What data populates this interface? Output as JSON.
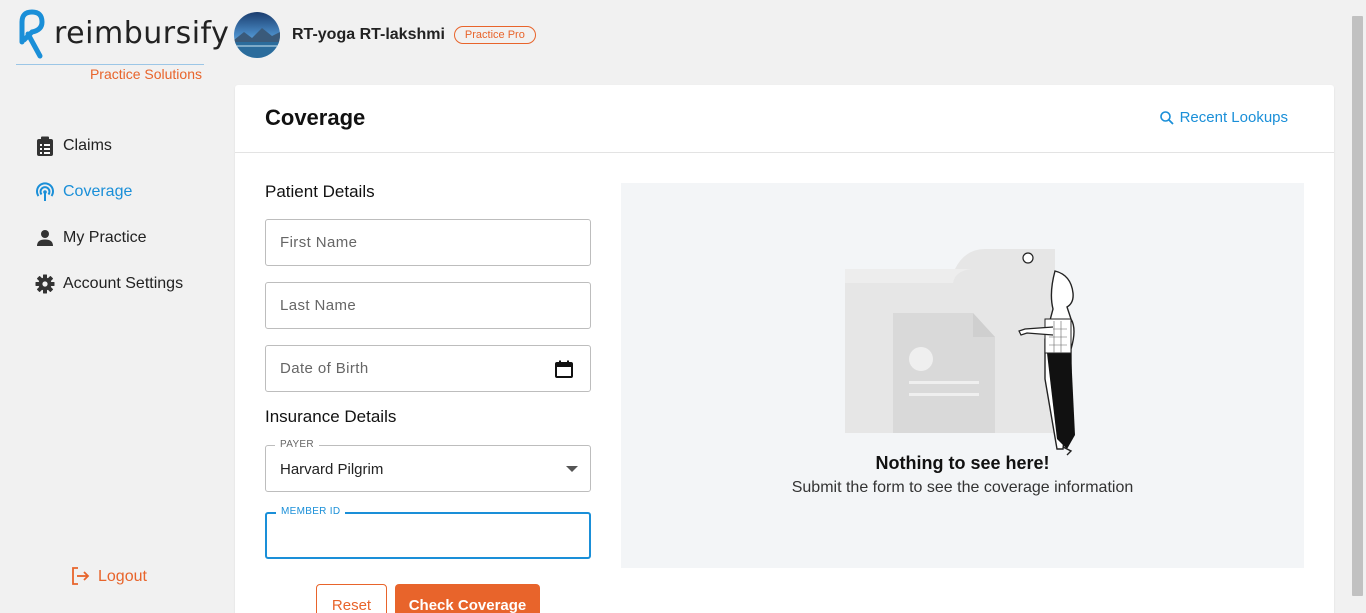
{
  "brand": {
    "name": "reimbursify",
    "subtitle": "Practice Solutions"
  },
  "sidebar": {
    "items": [
      {
        "label": "Claims",
        "icon": "clipboard-icon",
        "active": false
      },
      {
        "label": "Coverage",
        "icon": "coverage-signal-icon",
        "active": true
      },
      {
        "label": "My Practice",
        "icon": "person-icon",
        "active": false
      },
      {
        "label": "Account Settings",
        "icon": "gear-icon",
        "active": false
      }
    ],
    "logout_label": "Logout"
  },
  "header": {
    "user_name": "RT-yoga RT-lakshmi",
    "plan_badge": "Practice Pro"
  },
  "main": {
    "title": "Coverage",
    "recent_lookups": "Recent Lookups",
    "patient_section": "Patient Details",
    "first_name_placeholder": "First Name",
    "last_name_placeholder": "Last Name",
    "dob_placeholder": "Date of Birth",
    "insurance_section": "Insurance Details",
    "payer_label": "PAYER",
    "payer_value": "Harvard Pilgrim",
    "member_id_label": "MEMBER ID",
    "member_id_value": "",
    "reset_label": "Reset",
    "check_label": "Check Coverage",
    "empty_title": "Nothing to see here!",
    "empty_subtitle": "Submit the form to see the coverage information"
  },
  "colors": {
    "accent_orange": "#e8642b",
    "accent_blue": "#1a8fd8",
    "background": "#f1f1f1"
  }
}
